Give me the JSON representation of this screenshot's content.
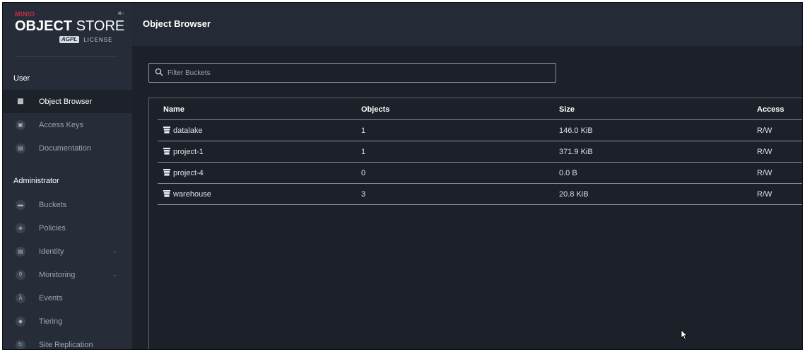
{
  "brand": {
    "vendor": "MINIO",
    "product_bold": "OBJECT",
    "product_light": "STORE",
    "license_badge": "AGPL",
    "license_label": "LICENSE"
  },
  "sidebar": {
    "user_section": "User",
    "user_items": [
      {
        "label": "Object Browser",
        "icon": "bucket-grid-icon",
        "active": true
      },
      {
        "label": "Access Keys",
        "icon": "key-card-icon"
      },
      {
        "label": "Documentation",
        "icon": "document-icon"
      }
    ],
    "admin_section": "Administrator",
    "admin_items": [
      {
        "label": "Buckets",
        "icon": "bucket-icon"
      },
      {
        "label": "Policies",
        "icon": "shield-icon"
      },
      {
        "label": "Identity",
        "icon": "id-card-icon",
        "expandable": true
      },
      {
        "label": "Monitoring",
        "icon": "magnifier-icon",
        "expandable": true
      },
      {
        "label": "Events",
        "icon": "lambda-icon"
      },
      {
        "label": "Tiering",
        "icon": "layers-icon"
      },
      {
        "label": "Site Replication",
        "icon": "sync-icon"
      }
    ]
  },
  "header": {
    "title": "Object Browser"
  },
  "search": {
    "placeholder": "Filter Buckets",
    "value": ""
  },
  "table": {
    "columns": [
      "Name",
      "Objects",
      "Size",
      "Access"
    ],
    "rows": [
      {
        "name": "datalake",
        "objects": "1",
        "size": "146.0 KiB",
        "access": "R/W"
      },
      {
        "name": "project-1",
        "objects": "1",
        "size": "371.9 KiB",
        "access": "R/W"
      },
      {
        "name": "project-4",
        "objects": "0",
        "size": "0.0 B",
        "access": "R/W"
      },
      {
        "name": "warehouse",
        "objects": "3",
        "size": "20.8 KiB",
        "access": "R/W"
      }
    ]
  },
  "colors": {
    "sidebar_bg": "#262d38",
    "content_bg": "#1c2029",
    "brand_accent": "#c72c48"
  }
}
